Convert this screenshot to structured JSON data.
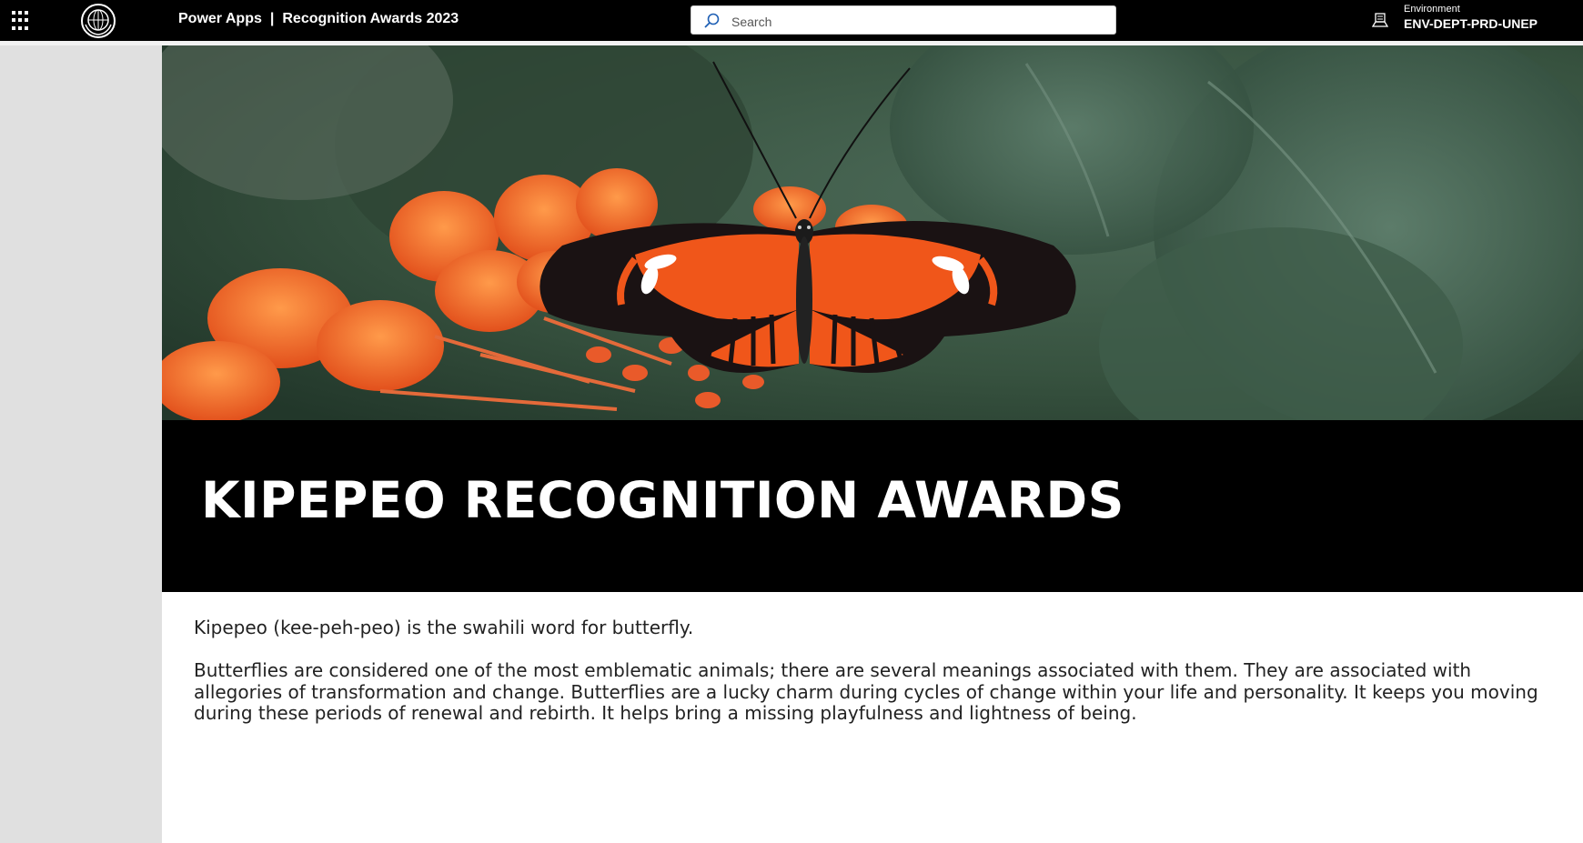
{
  "header": {
    "product": "Power Apps",
    "separator": "|",
    "app_name": "Recognition Awards 2023",
    "search_placeholder": "Search",
    "environment_label": "Environment",
    "environment_value": "ENV-DEPT-PRD-UNEP"
  },
  "main": {
    "title": "KIPEPEO RECOGNITION AWARDS",
    "paragraphs": [
      "Kipepeo (kee-peh-peo) is the swahili word for butterfly.",
      "Butterflies are considered one of the most emblematic animals; there are several meanings associated with them. They are associated with allegories of transformation and change. Butterflies are a lucky charm during cycles of change within your life and personality. It keeps you moving during these periods of renewal and rebirth. It helps bring a missing playfulness and lightness of being."
    ]
  },
  "colors": {
    "topbar": "#000000",
    "banner": "#000000",
    "sidebar": "#e0e0e0",
    "butterfly_orange": "#f0561a"
  },
  "icons": {
    "app_launcher": "waffle-icon",
    "logo": "un-emblem-icon",
    "search": "search-icon",
    "environment": "environment-icon"
  }
}
